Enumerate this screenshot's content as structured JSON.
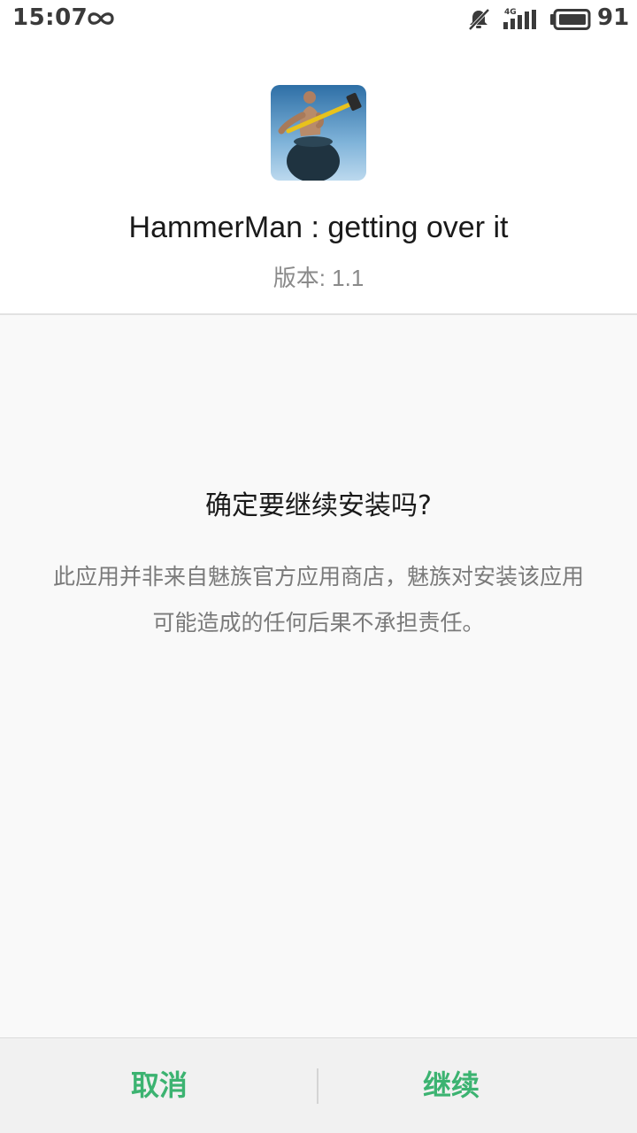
{
  "status_bar": {
    "time": "15:07",
    "network_type": "4G",
    "battery_level": "91",
    "icons": [
      "infinity-icon",
      "notification-muted-icon",
      "signal-icon",
      "battery-icon"
    ]
  },
  "app": {
    "name": "HammerMan : getting over it",
    "version": "版本: 1.1",
    "icon": "app-icon-hammerman"
  },
  "dialog": {
    "title": "确定要继续安装吗?",
    "message": "此应用并非来自魅族官方应用商店，魅族对安装该应用可能造成的任何后果不承担责任。"
  },
  "actions": {
    "cancel_label": "取消",
    "continue_label": "继续"
  },
  "colors": {
    "accent": "#3cb371",
    "content_bg": "#f9f9f9",
    "footer_bg": "#f1f1f1"
  }
}
